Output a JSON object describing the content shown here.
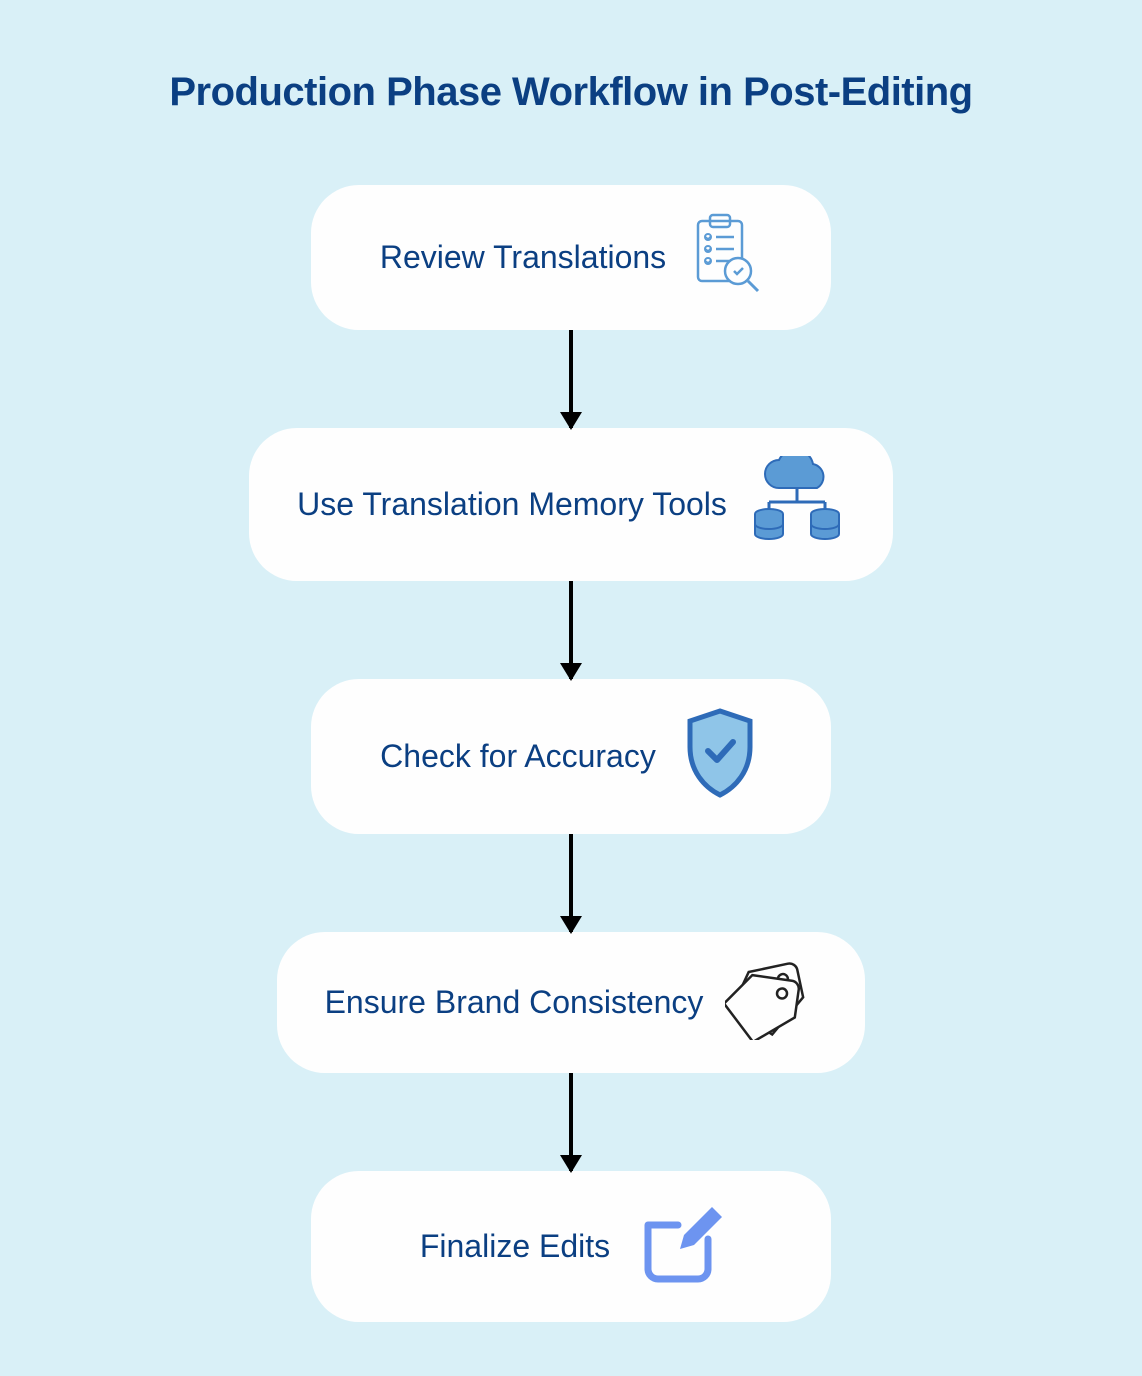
{
  "title": "Production Phase Workflow in Post-Editing",
  "steps": [
    {
      "label": "Review Translations",
      "icon": "clipboard-search-icon"
    },
    {
      "label": "Use Translation Memory Tools",
      "icon": "cloud-database-icon"
    },
    {
      "label": "Check for Accuracy",
      "icon": "shield-check-icon"
    },
    {
      "label": "Ensure Brand Consistency",
      "icon": "tags-icon"
    },
    {
      "label": "Finalize Edits",
      "icon": "edit-icon"
    }
  ],
  "colors": {
    "background": "#d9f0f7",
    "text": "#0b3f82",
    "card": "#fefefe",
    "iconPrimary": "#5b9bd5",
    "iconAccent": "#2e6bb8"
  }
}
